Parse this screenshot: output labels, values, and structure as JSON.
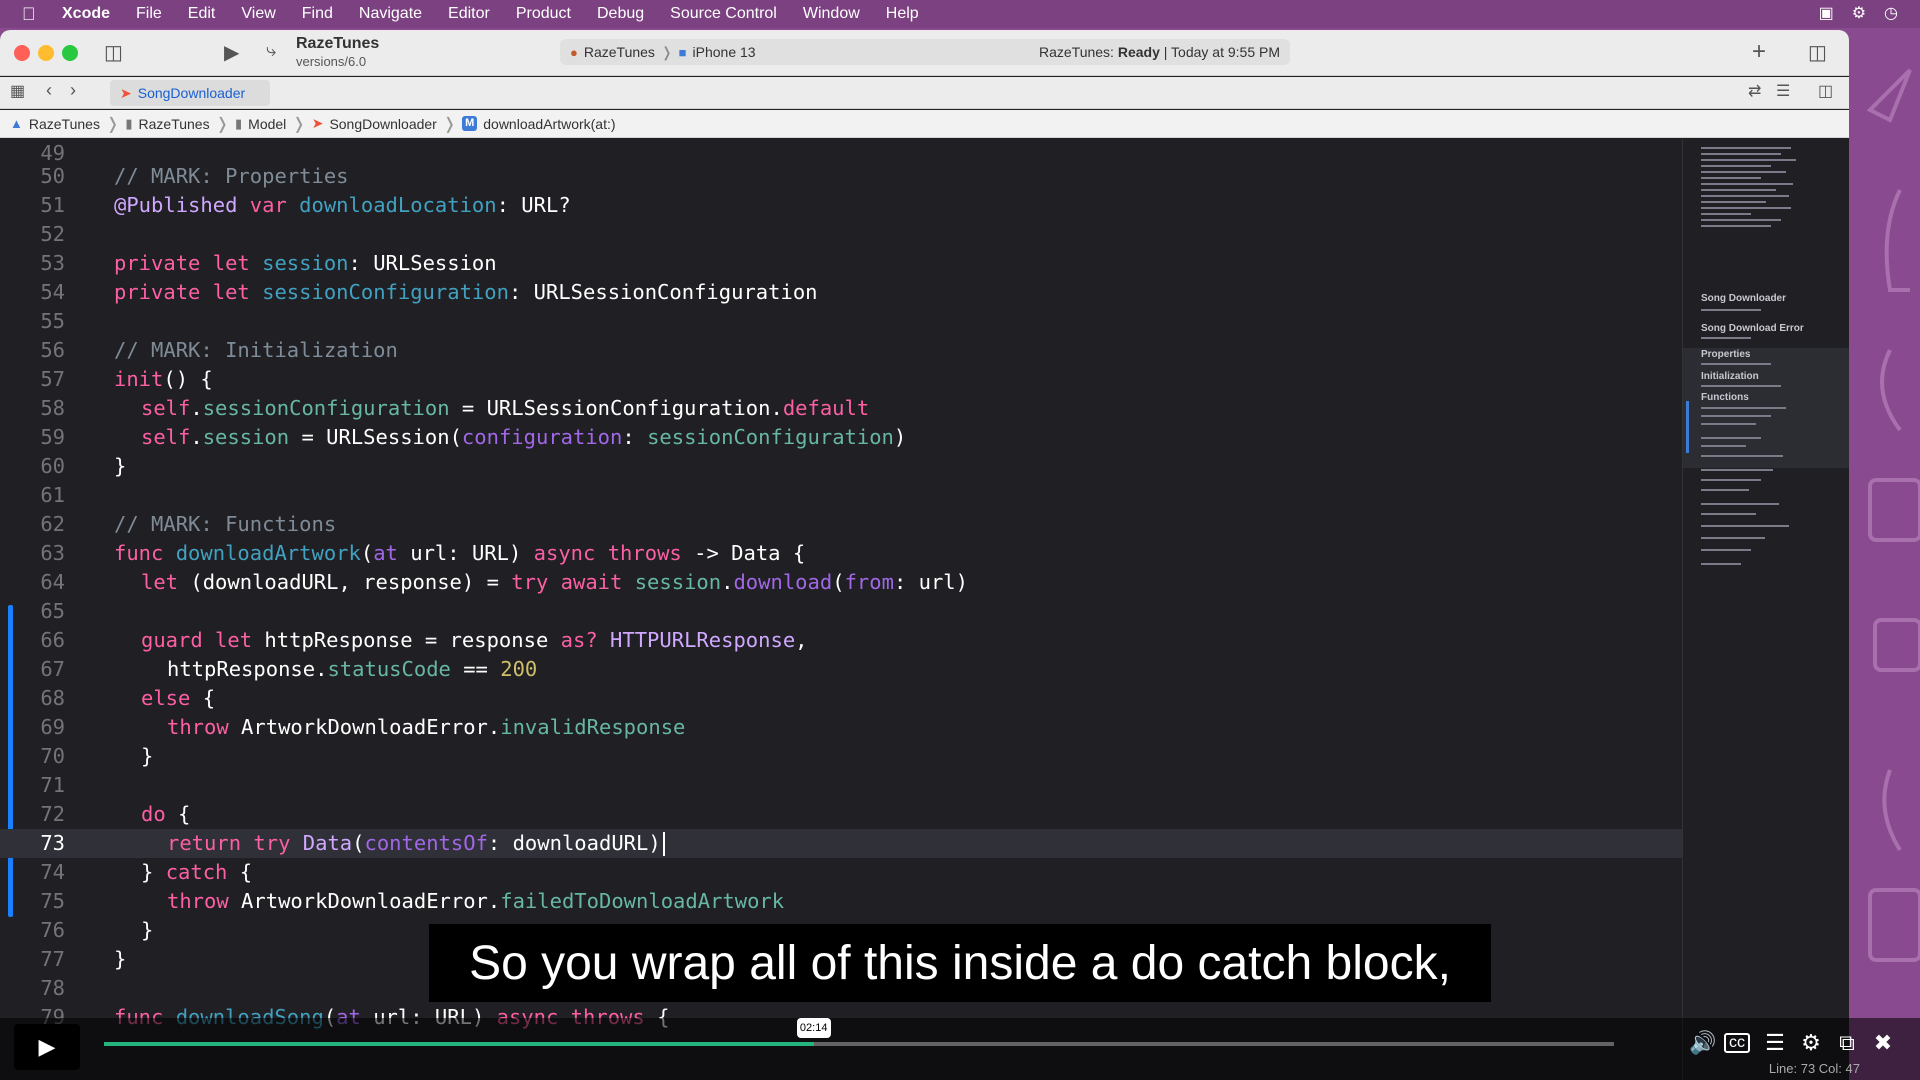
{
  "menubar": {
    "app": "Xcode",
    "items": [
      "File",
      "Edit",
      "View",
      "Find",
      "Navigate",
      "Editor",
      "Product",
      "Debug",
      "Source Control",
      "Window",
      "Help"
    ]
  },
  "toolbar": {
    "project_name": "RazeTunes",
    "project_branch": "versions/6.0",
    "scheme": "RazeTunes",
    "device": "iPhone 13",
    "status_prefix": "RazeTunes:",
    "status_state": "Ready",
    "status_time": "| Today at 9:55 PM"
  },
  "tab": {
    "label": "SongDownloader"
  },
  "breadcrumbs": [
    "RazeTunes",
    "RazeTunes",
    "Model",
    "SongDownloader",
    "downloadArtwork(at:)"
  ],
  "editor": {
    "current_line": "73",
    "lines": {
      "l49": "49",
      "l50": "50",
      "l51": "51",
      "l52": "52",
      "l53": "53",
      "l54": "54",
      "l55": "55",
      "l56": "56",
      "l57": "57",
      "l58": "58",
      "l59": "59",
      "l60": "60",
      "l61": "61",
      "l62": "62",
      "l63": "63",
      "l64": "64",
      "l65": "65",
      "l66": "66",
      "l67": "67",
      "l68": "68",
      "l69": "69",
      "l70": "70",
      "l71": "71",
      "l72": "72",
      "l73": "73",
      "l74": "74",
      "l75": "75",
      "l76": "76",
      "l77": "77",
      "l78": "78",
      "l79": "79"
    },
    "code": {
      "c50": "// MARK: Properties",
      "c51a": "@Published",
      "c51b": " var ",
      "c51c": "downloadLocation",
      "c51d": ": URL?",
      "c53a": "private let ",
      "c53b": "session",
      "c53c": ": URLSession",
      "c54a": "private let ",
      "c54b": "sessionConfiguration",
      "c54c": ": URLSessionConfiguration",
      "c56": "// MARK: Initialization",
      "c57a": "init",
      "c57b": "() {",
      "c58a": "self",
      "c58b": ".",
      "c58c": "sessionConfiguration",
      "c58d": " = URLSessionConfiguration.",
      "c58e": "default",
      "c59a": "self",
      "c59b": ".",
      "c59c": "session",
      "c59d": " = URLSession(",
      "c59e": "configuration",
      "c59f": ": ",
      "c59g": "sessionConfiguration",
      "c59h": ")",
      "c60": "}",
      "c62": "// MARK: Functions",
      "c63a": "func ",
      "c63b": "downloadArtwork",
      "c63c": "(",
      "c63d": "at",
      "c63e": " url: URL) ",
      "c63f": "async throws",
      "c63g": " -> Data {",
      "c64a": "let",
      "c64b": " (downloadURL, response) = ",
      "c64c": "try await",
      "c64d": " ",
      "c64e": "session",
      "c64f": ".",
      "c64g": "download",
      "c64h": "(",
      "c64i": "from",
      "c64j": ": url)",
      "c66a": "guard let",
      "c66b": " httpResponse = response ",
      "c66c": "as?",
      "c66d": " ",
      "c66e": "HTTPURLResponse",
      "c66f": ",",
      "c67a": "httpResponse.",
      "c67b": "statusCode",
      "c67c": " == ",
      "c67d": "200",
      "c68a": "else",
      "c68b": " {",
      "c69a": "throw",
      "c69b": " ArtworkDownloadError.",
      "c69c": "invalidResponse",
      "c70": "}",
      "c72a": "do",
      "c72b": " {",
      "c73a": "return try",
      "c73b": " ",
      "c73c": "Data",
      "c73d": "(",
      "c73e": "contentsOf",
      "c73f": ": downloadURL)",
      "c74a": "} ",
      "c74b": "catch",
      "c74c": " {",
      "c75a": "throw",
      "c75b": " ArtworkDownloadError.",
      "c75c": "failedToDownloadArtwork",
      "c76": "}",
      "c77": "}",
      "c79a": "func ",
      "c79b": "downloadSong",
      "c79c": "(",
      "c79d": "at",
      "c79e": " url: URL) ",
      "c79f": "async throws",
      "c79g": " {"
    }
  },
  "minimap": {
    "labels": [
      "Song Downloader",
      "Song Download Error",
      "Properties",
      "Initialization",
      "Functions"
    ]
  },
  "video": {
    "subtitle": "So you wrap all of this inside a do catch block,",
    "timestamp": "02:14",
    "progress": 0.47,
    "status_text": "Line: 73  Col: 47"
  },
  "colors": {
    "keyword": "#fc5fa3",
    "comment": "#7f8c98",
    "type": "#d0a8ff",
    "property": "#67b7a4",
    "declaration": "#41a1c0",
    "number": "#d0bf69",
    "progress": "#25b47e"
  },
  "icons": {
    "apple": "apple-logo-icon",
    "sidebar_toggle": "sidebar-toggle-icon",
    "run": "play-icon",
    "branch": "branch-icon",
    "add": "plus-icon",
    "inspector": "inspector-toggle-icon"
  }
}
